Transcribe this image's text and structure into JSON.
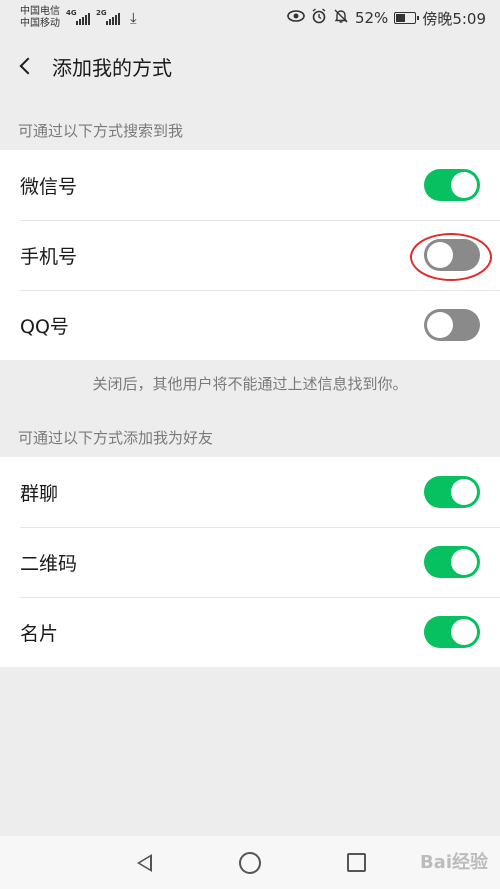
{
  "status": {
    "carrier1": "中国电信",
    "carrier2": "中国移动",
    "net1": "4G",
    "net2": "2G",
    "battery_percent": "52%",
    "battery_level": 0.52,
    "time": "傍晚5:09",
    "icons": [
      "download-icon",
      "eye-icon",
      "alarm-icon",
      "bell-off-icon"
    ]
  },
  "header": {
    "title": "添加我的方式",
    "back_icon": "chevron-left-icon"
  },
  "search_section": {
    "label": "可通过以下方式搜索到我",
    "items": [
      {
        "label": "微信号",
        "on": true
      },
      {
        "label": "手机号",
        "on": false
      },
      {
        "label": "QQ号",
        "on": false
      }
    ],
    "note": "关闭后，其他用户将不能通过上述信息找到你。"
  },
  "add_section": {
    "label": "可通过以下方式添加我为好友",
    "items": [
      {
        "label": "群聊",
        "on": true
      },
      {
        "label": "二维码",
        "on": true
      },
      {
        "label": "名片",
        "on": true
      }
    ]
  },
  "colors": {
    "toggle_on": "#07c160",
    "toggle_off": "#8a8a8a",
    "annotation": "#e22a2a"
  },
  "nav": {
    "icons": [
      "back-triangle-icon",
      "home-circle-icon",
      "recents-square-icon"
    ]
  },
  "watermark": "Bai经验"
}
